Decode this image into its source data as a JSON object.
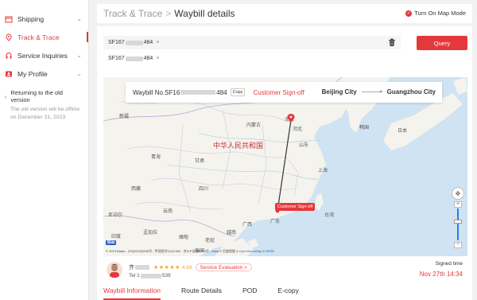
{
  "sidebar": {
    "items": [
      {
        "label": "Shipping",
        "icon": "box-icon",
        "expandable": true
      },
      {
        "label": "Track & Trace",
        "icon": "location-pin-icon",
        "active": true
      },
      {
        "label": "Service Inquiries",
        "icon": "headset-icon",
        "expandable": true
      },
      {
        "label": "My Profile",
        "icon": "profile-card-icon",
        "expandable": true
      }
    ],
    "old_version_title": "Returning to the old version",
    "old_version_note": "The old version will be offline on December 31, 2023"
  },
  "header": {
    "breadcrumb_root": "Track & Trace",
    "breadcrumb_sep": ">",
    "title": "Waybill details",
    "map_mode_label": "Turn On Map Mode"
  },
  "query": {
    "chip_prefix": "SF167",
    "chip_suffix": "484",
    "query_button": "Query",
    "history_prefix": "SF167",
    "history_suffix": "484"
  },
  "map": {
    "waybill_label_prefix": "Waybill No.SF16",
    "waybill_label_suffix": "484",
    "copy_label": "Copy",
    "status": "Customer Sign-off",
    "origin": "Beijing City",
    "destination": "Guangzhou City",
    "country_label": "中华人民共和国",
    "signoff_tag": "Customer Sign-off",
    "baidu_logo": "Bai",
    "copyright": "© 2023 Baidu - GS(2023)3206号 - 甲测资字11111342 - 京ICP证030173号 - Data © 百度智图 &",
    "copyright_link": "OpenStreetMap & HERE",
    "place_labels": {
      "nei_menggu": "内蒙古",
      "xinjiang": "新疆",
      "gansu": "甘肃",
      "qinghai": "青海",
      "xizang": "西藏",
      "sichuan": "四川",
      "yunnan": "云南",
      "guangxi": "广西",
      "hebei": "河北",
      "shandong": "山东",
      "beijing": "北京",
      "shanghai": "上海",
      "guangdong": "广东",
      "taiwan": "台湾",
      "korea": "韩国",
      "japan": "日本",
      "mongolia": "蒙古",
      "india": "印度",
      "myanmar": "缅甸",
      "laos": "老挝",
      "vietnam": "越南",
      "thailand": "泰国",
      "nepal": "尼泊尔",
      "bangladesh": "孟加拉"
    }
  },
  "courier": {
    "name_prefix": "齐",
    "stars": "★★★★★",
    "rating": "4.99",
    "evaluation_button": "Service Evaluation >",
    "tel_prefix": "Tel 1",
    "tel_suffix": "539",
    "signed_label": "Signed time",
    "signed_time": "Nov 27th 14:34"
  },
  "tabs": [
    {
      "label": "Waybill Information",
      "active": true
    },
    {
      "label": "Route Details"
    },
    {
      "label": "POD"
    },
    {
      "label": "E-copy"
    }
  ],
  "colors": {
    "accent": "#e4393c",
    "map_water": "#cfe3f2",
    "map_land": "#f5f3ed"
  }
}
